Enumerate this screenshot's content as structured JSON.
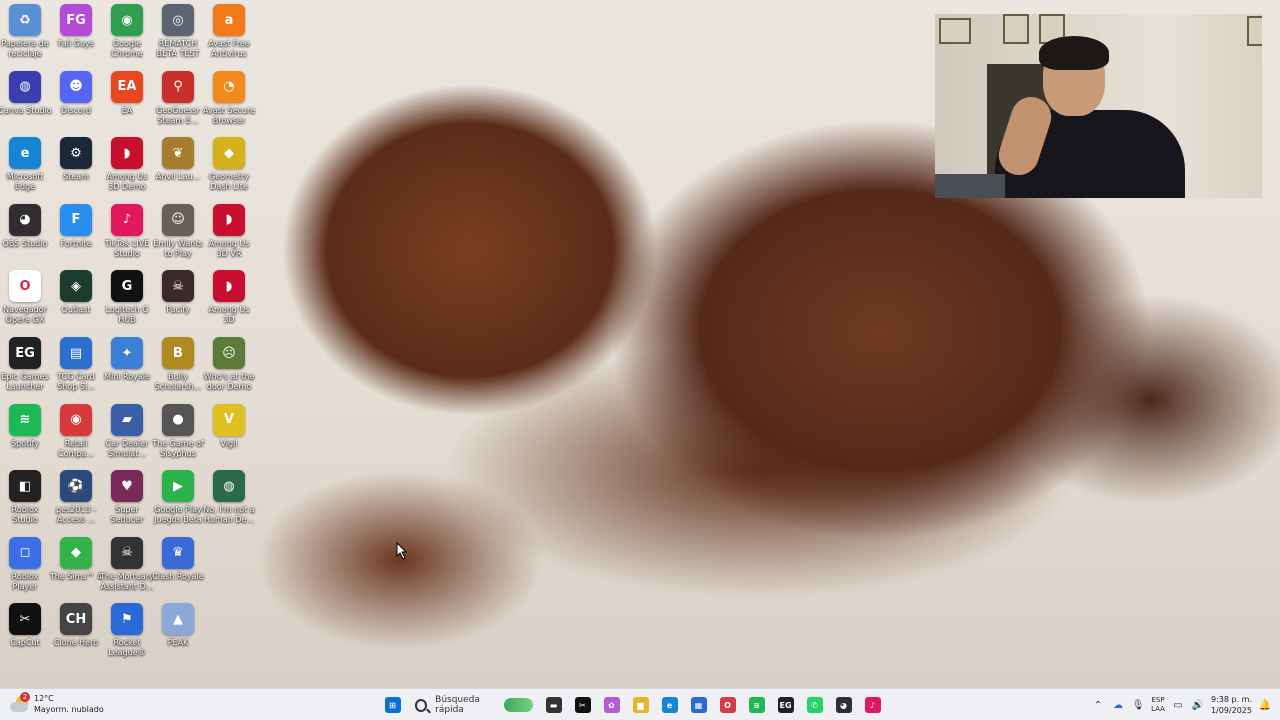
{
  "desktop_icons": [
    {
      "label": "Papelera de reciclaje",
      "icon": "recycle-bin-icon",
      "color": "#5a8fd6",
      "glyph": "♻",
      "col": 0,
      "row": 0
    },
    {
      "label": "Fall Guys",
      "icon": "fall-guys-icon",
      "color": "#b44bd6",
      "glyph": "FG",
      "col": 1,
      "row": 0
    },
    {
      "label": "Google Chrome",
      "icon": "chrome-icon",
      "color": "#2f9e4f",
      "glyph": "◉",
      "col": 2,
      "row": 0
    },
    {
      "label": "REMATCH BETA TEST",
      "icon": "rematch-icon",
      "color": "#5b6470",
      "glyph": "◎",
      "col": 3,
      "row": 0
    },
    {
      "label": "Avast Free Antivirus",
      "icon": "avast-icon",
      "color": "#f07a1a",
      "glyph": "a",
      "col": 4,
      "row": 0
    },
    {
      "label": "Canva Studio",
      "icon": "camo-studio-icon",
      "color": "#3a3fb0",
      "glyph": "◍",
      "col": 0,
      "row": 1
    },
    {
      "label": "Discord",
      "icon": "discord-icon",
      "color": "#5865f2",
      "glyph": "☻",
      "col": 1,
      "row": 1
    },
    {
      "label": "EA",
      "icon": "ea-icon",
      "color": "#e8471f",
      "glyph": "EA",
      "col": 2,
      "row": 1
    },
    {
      "label": "GeoGuessr Steam E...",
      "icon": "geoguessr-icon",
      "color": "#c9302c",
      "glyph": "⚲",
      "col": 3,
      "row": 1
    },
    {
      "label": "Avast Secure Browser",
      "icon": "avast-browser-icon",
      "color": "#f28a1c",
      "glyph": "◔",
      "col": 4,
      "row": 1
    },
    {
      "label": "Microsoft Edge",
      "icon": "edge-icon",
      "color": "#1584d6",
      "glyph": "e",
      "col": 0,
      "row": 2
    },
    {
      "label": "Steam",
      "icon": "steam-icon",
      "color": "#1b2838",
      "glyph": "⚙",
      "col": 1,
      "row": 2
    },
    {
      "label": "Among Us 3D Demo",
      "icon": "among-us-icon",
      "color": "#c8102e",
      "glyph": "◗",
      "col": 2,
      "row": 2
    },
    {
      "label": "Anvil Lau...",
      "icon": "anvil-icon",
      "color": "#a67c2e",
      "glyph": "❦",
      "col": 3,
      "row": 2
    },
    {
      "label": "Geometry Dash Lite",
      "icon": "geometry-dash-icon",
      "color": "#d6b21a",
      "glyph": "◆",
      "col": 4,
      "row": 2
    },
    {
      "label": "OBS Studio",
      "icon": "obs-icon",
      "color": "#302e31",
      "glyph": "◕",
      "col": 0,
      "row": 3
    },
    {
      "label": "Fortnite",
      "icon": "fortnite-icon",
      "color": "#2a8ef0",
      "glyph": "F",
      "col": 1,
      "row": 3
    },
    {
      "label": "TikTok LIVE Studio",
      "icon": "tiktok-live-icon",
      "color": "#e2185e",
      "glyph": "♪",
      "col": 2,
      "row": 3
    },
    {
      "label": "Emily Wants to Play",
      "icon": "emily-icon",
      "color": "#6b5f55",
      "glyph": "☺",
      "col": 3,
      "row": 3
    },
    {
      "label": "Among Us 3D VR",
      "icon": "among-us-vr-icon",
      "color": "#c8102e",
      "glyph": "◗",
      "col": 4,
      "row": 3
    },
    {
      "label": "Navegador Opera GX",
      "icon": "opera-gx-icon",
      "color": "#ffffff",
      "glyph": "O",
      "col": 0,
      "row": 4
    },
    {
      "label": "Outlast",
      "icon": "outlast-icon",
      "color": "#1e3b2f",
      "glyph": "◈",
      "col": 1,
      "row": 4
    },
    {
      "label": "Logitech G HUB",
      "icon": "logitech-icon",
      "color": "#111111",
      "glyph": "G",
      "col": 2,
      "row": 4
    },
    {
      "label": "Pacify",
      "icon": "pacify-icon",
      "color": "#3a2a2a",
      "glyph": "☠",
      "col": 3,
      "row": 4
    },
    {
      "label": "Among Us 3D",
      "icon": "among-us-3d-icon",
      "color": "#c8102e",
      "glyph": "◗",
      "col": 4,
      "row": 4
    },
    {
      "label": "Epic Games Launcher",
      "icon": "epic-games-icon",
      "color": "#222222",
      "glyph": "EG",
      "col": 0,
      "row": 5
    },
    {
      "label": "TCG Card Shop Si...",
      "icon": "tcg-icon",
      "color": "#2c6fd1",
      "glyph": "▤",
      "col": 1,
      "row": 5
    },
    {
      "label": "Mini Royale",
      "icon": "mini-royale-icon",
      "color": "#3c7fd6",
      "glyph": "✦",
      "col": 2,
      "row": 5
    },
    {
      "label": "Bully Scholarsh...",
      "icon": "bully-icon",
      "color": "#b08a20",
      "glyph": "B",
      "col": 3,
      "row": 5
    },
    {
      "label": "Who's at the door Demo",
      "icon": "whos-door-icon",
      "color": "#5e7a3a",
      "glyph": "☹",
      "col": 4,
      "row": 5
    },
    {
      "label": "Spotify",
      "icon": "spotify-icon",
      "color": "#1db954",
      "glyph": "≋",
      "col": 0,
      "row": 6
    },
    {
      "label": "Retail Compa...",
      "icon": "retail-icon",
      "color": "#d63a3a",
      "glyph": "◉",
      "col": 1,
      "row": 6
    },
    {
      "label": "Car Dealer Simulat...",
      "icon": "car-dealer-icon",
      "color": "#3a5fa8",
      "glyph": "▰",
      "col": 2,
      "row": 6
    },
    {
      "label": "The Game of Sisyphus",
      "icon": "sisyphus-icon",
      "color": "#555555",
      "glyph": "●",
      "col": 3,
      "row": 6
    },
    {
      "label": "Vigil",
      "icon": "vigil-icon",
      "color": "#e0c020",
      "glyph": "V",
      "col": 4,
      "row": 6
    },
    {
      "label": "Roblox Studio",
      "icon": "roblox-studio-icon",
      "color": "#222222",
      "glyph": "◧",
      "col": 0,
      "row": 7
    },
    {
      "label": "pes2013 - Acceso ...",
      "icon": "pes-icon",
      "color": "#2a4a7a",
      "glyph": "⚽",
      "col": 1,
      "row": 7
    },
    {
      "label": "Super Seducer",
      "icon": "super-seducer-icon",
      "color": "#7a2a5a",
      "glyph": "♥",
      "col": 2,
      "row": 7
    },
    {
      "label": "Google Play Juegos Beta",
      "icon": "google-play-icon",
      "color": "#2bb24c",
      "glyph": "▶",
      "col": 3,
      "row": 7
    },
    {
      "label": "No, I'm not a Human De...",
      "icon": "not-human-icon",
      "color": "#2a6a4a",
      "glyph": "◍",
      "col": 4,
      "row": 7
    },
    {
      "label": "Roblox Player",
      "icon": "roblox-player-icon",
      "color": "#3b6fe8",
      "glyph": "◻",
      "col": 0,
      "row": 8
    },
    {
      "label": "The Sims™ 4",
      "icon": "sims-icon",
      "color": "#36b24a",
      "glyph": "◆",
      "col": 1,
      "row": 8
    },
    {
      "label": "The Mortuary Assistant D...",
      "icon": "mortuary-icon",
      "color": "#333333",
      "glyph": "☠",
      "col": 2,
      "row": 8
    },
    {
      "label": "Clash Royale",
      "icon": "clash-royale-icon",
      "color": "#3a6ad6",
      "glyph": "♛",
      "col": 3,
      "row": 8
    },
    {
      "label": "CapCut",
      "icon": "capcut-icon",
      "color": "#111111",
      "glyph": "✂",
      "col": 0,
      "row": 9
    },
    {
      "label": "Clone Hero",
      "icon": "clone-hero-icon",
      "color": "#444444",
      "glyph": "CH",
      "col": 1,
      "row": 9
    },
    {
      "label": "Rocket League®",
      "icon": "rocket-league-icon",
      "color": "#2a6ad6",
      "glyph": "⚑",
      "col": 2,
      "row": 9
    },
    {
      "label": "PEAK",
      "icon": "peak-icon",
      "color": "#8aa8d8",
      "glyph": "▲",
      "col": 3,
      "row": 9
    }
  ],
  "weather": {
    "temperature": "12°C",
    "condition": "Mayorm. nublado",
    "badge": "2"
  },
  "taskbar": {
    "search_placeholder": "Búsqueda rápida",
    "apps": [
      {
        "name": "start-button",
        "glyph": "⊞",
        "color": "#0a6fd6"
      },
      {
        "name": "search",
        "glyph": "",
        "color": ""
      },
      {
        "name": "terminal-icon",
        "glyph": "▬",
        "color": "#333333"
      },
      {
        "name": "capcut-taskbar-icon",
        "glyph": "✂",
        "color": "#111111"
      },
      {
        "name": "copilot-icon",
        "glyph": "✿",
        "color": "#b35ad6"
      },
      {
        "name": "file-explorer-icon",
        "glyph": "▆",
        "color": "#e8b42a"
      },
      {
        "name": "edge-taskbar-icon",
        "glyph": "e",
        "color": "#1584d6"
      },
      {
        "name": "store-icon",
        "glyph": "▦",
        "color": "#2a6ad6"
      },
      {
        "name": "opera-taskbar-icon",
        "glyph": "O",
        "color": "#d63a4a"
      },
      {
        "name": "spotify-taskbar-icon",
        "glyph": "≋",
        "color": "#1db954"
      },
      {
        "name": "epic-taskbar-icon",
        "glyph": "EG",
        "color": "#222222"
      },
      {
        "name": "whatsapp-icon",
        "glyph": "✆",
        "color": "#25d366"
      },
      {
        "name": "obs-taskbar-icon",
        "glyph": "◕",
        "color": "#302e31"
      },
      {
        "name": "tiktok-taskbar-icon",
        "glyph": "♪",
        "color": "#e2185e"
      }
    ]
  },
  "tray": {
    "lang_top": "ESP",
    "lang_bottom": "LAA",
    "time": "9:38 p. m.",
    "date": "1/09/2025"
  }
}
